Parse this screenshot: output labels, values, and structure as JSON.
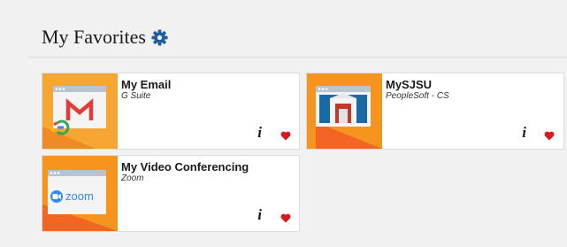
{
  "header": {
    "title": "My Favorites",
    "settings_icon": "gear-icon"
  },
  "colors": {
    "accent_orange": "#f7941d",
    "heart_red": "#d71920",
    "gear_blue": "#1f5d9e"
  },
  "favorites": [
    {
      "name": "My Email",
      "subtitle": "G Suite",
      "info_label": "i",
      "icon": "gmail-icon"
    },
    {
      "name": "MySJSU",
      "subtitle": "PeopleSoft - CS",
      "info_label": "i",
      "icon": "building-icon"
    },
    {
      "name": "My Video Conferencing",
      "subtitle": "Zoom",
      "info_label": "i",
      "icon": "zoom-icon",
      "logo_text": "zoom"
    }
  ]
}
